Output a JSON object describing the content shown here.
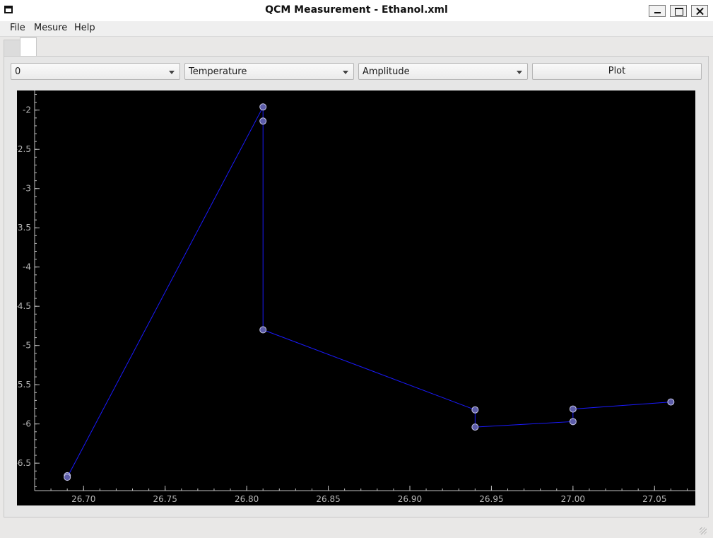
{
  "window": {
    "title": "QCM Measurement - Ethanol.xml"
  },
  "menu": {
    "items": [
      "File",
      "Mesure",
      "Help"
    ]
  },
  "controls": {
    "combo_sample": "0",
    "combo_x": "Temperature",
    "combo_y": "Amplitude",
    "plot_button": "Plot"
  },
  "colors": {
    "plot_background": "#000000",
    "series_line": "#1a1aff",
    "marker_fill": "#5c5ca8",
    "marker_edge": "#c8c8e8",
    "axis": "#c0c0c0"
  },
  "chart_data": {
    "type": "line",
    "title": "",
    "xlabel": "",
    "ylabel": "",
    "xlim": [
      26.67,
      27.075
    ],
    "ylim": [
      -6.85,
      -1.75
    ],
    "grid": false,
    "x_ticks": [
      26.7,
      26.75,
      26.8,
      26.85,
      26.9,
      26.95,
      27.0,
      27.05
    ],
    "x_tick_labels": [
      "26.70",
      "26.75",
      "26.80",
      "26.85",
      "26.90",
      "26.95",
      "27.00",
      "27.05"
    ],
    "y_ticks": [
      -2,
      -2.5,
      -3,
      -3.5,
      -4,
      -4.5,
      -5,
      -5.5,
      -6,
      -6.5
    ],
    "y_tick_labels": [
      "-2",
      "-2.5",
      "-3",
      "-3.5",
      "-4",
      "-4.5",
      "-5",
      "-5.5",
      "-6",
      "-6.5"
    ],
    "series": [
      {
        "x": [
          26.69,
          26.69,
          26.81,
          26.81,
          26.81,
          26.94,
          26.94,
          27.0,
          27.0,
          27.06
        ],
        "y": [
          -6.66,
          -6.68,
          -1.96,
          -2.14,
          -4.8,
          -5.82,
          -6.04,
          -5.97,
          -5.81,
          -5.72
        ]
      }
    ]
  }
}
